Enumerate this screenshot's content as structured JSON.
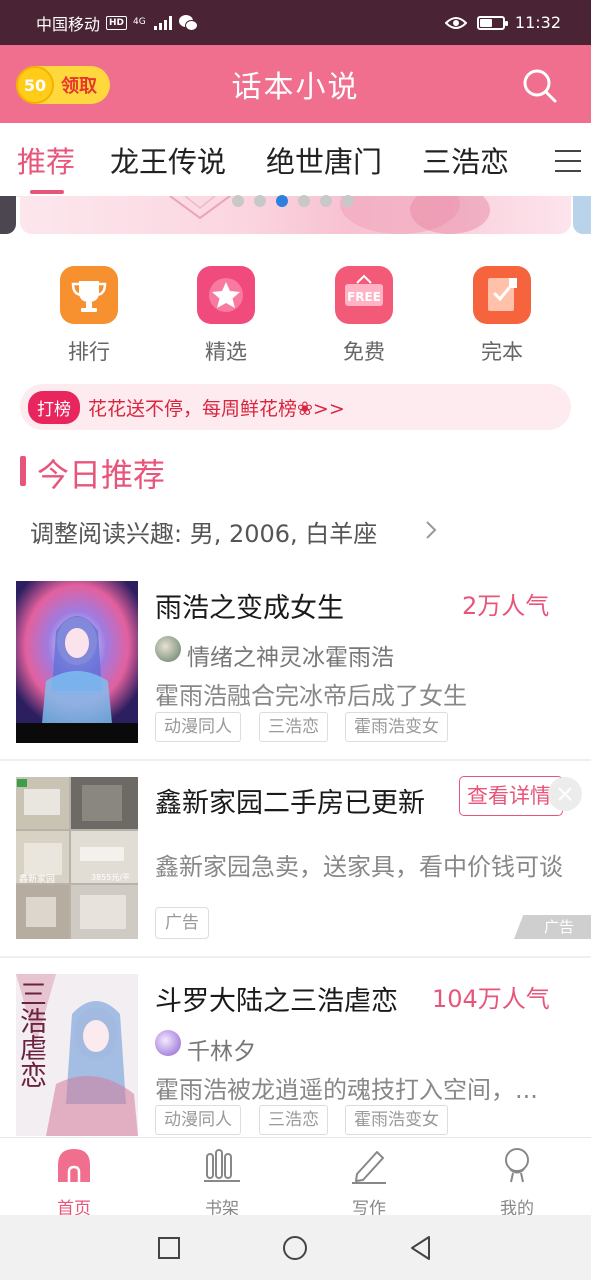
{
  "status_bar": {
    "carrier": "中国移动",
    "hd": "HD",
    "net": "4G",
    "time": "11:32",
    "battery_level": 0.55
  },
  "header": {
    "coin_value": "50",
    "coin_label": "领取",
    "title": "话本小说"
  },
  "tabs": [
    {
      "label": "推荐",
      "active": true
    },
    {
      "label": "龙王传说"
    },
    {
      "label": "绝世唐门"
    },
    {
      "label": "三浩恋"
    },
    {
      "label": "…"
    }
  ],
  "banner": {
    "page_count": 6,
    "active_page": 3
  },
  "quick_entries": [
    {
      "label": "排行",
      "icon": "trophy-icon",
      "color": "#f7902f"
    },
    {
      "label": "精选",
      "icon": "star-icon",
      "color": "#f04b7c"
    },
    {
      "label": "免费",
      "icon": "free-sign-icon",
      "color": "#f35a77",
      "icon_text": "FREE"
    },
    {
      "label": "完本",
      "icon": "finished-book-icon",
      "color": "#f6643d"
    }
  ],
  "promo": {
    "tag": "打榜",
    "text": "花花送不停，每周鲜花榜❀>>"
  },
  "section": {
    "title": "今日推荐",
    "interest": "调整阅读兴趣: 男, 2006, 白羊座"
  },
  "feed": [
    {
      "title": "雨浩之变成女生",
      "popularity": "2万人气",
      "author": "情绪之神灵冰霍雨浩",
      "description": "霍雨浩融合完冰帝后成了女生",
      "tags": [
        "动漫同人",
        "三浩恋",
        "霍雨浩变女"
      ]
    },
    {
      "ad": true,
      "title": "鑫新家园二手房已更新",
      "button": "查看详情",
      "description": "鑫新家园急卖，送家具，看中价钱可谈",
      "ad_label": "广告",
      "corner_label": "广告",
      "cover_caption": "鑫新家园",
      "cover_price": "3855元/平"
    },
    {
      "title": "斗罗大陆之三浩虐恋",
      "popularity": "104万人气",
      "author": "千林夕",
      "description": "霍雨浩被龙逍遥的魂技打入空间，...",
      "tags": [
        "动漫同人",
        "三浩恋",
        "霍雨浩变女"
      ],
      "cover_text": "三浩虐恋"
    }
  ],
  "bottom_nav": [
    {
      "label": "首页",
      "active": true
    },
    {
      "label": "书架"
    },
    {
      "label": "写作"
    },
    {
      "label": "我的"
    }
  ]
}
